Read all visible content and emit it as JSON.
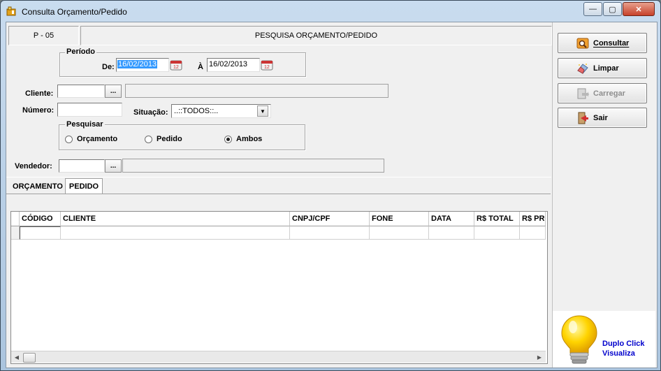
{
  "window": {
    "title": "Consulta Orçamento/Pedido",
    "minimize": "—",
    "maximize": "▢",
    "close": "✕"
  },
  "header": {
    "code": "P - 05",
    "title": "PESQUISA ORÇAMENTO/PEDIDO"
  },
  "periodo": {
    "legend": "Período",
    "from_label": "De:",
    "from_value": "16/02/2013",
    "to_label": "À",
    "to_value": "16/02/2013"
  },
  "filters": {
    "cliente_label": "Cliente:",
    "cliente_button": "...",
    "numero_label": "Número:",
    "situacao_label": "Situação:",
    "situacao_value": "..::TODOS::..",
    "vendedor_label": "Vendedor:",
    "vendedor_button": "..."
  },
  "pesquisar": {
    "legend": "Pesquisar",
    "options": [
      "Orçamento",
      "Pedido",
      "Ambos"
    ],
    "selected": "Ambos"
  },
  "tabs": [
    "ORÇAMENTO",
    "PEDIDO"
  ],
  "active_tab": "PEDIDO",
  "grid": {
    "columns": [
      "CÓDIGO",
      "CLIENTE",
      "CNPJ/CPF",
      "FONE",
      "DATA",
      "R$ TOTAL",
      "R$ PRO"
    ]
  },
  "buttons": {
    "consultar": "Consultar",
    "limpar": "Limpar",
    "carregar": "Carregar",
    "sair": "Sair"
  },
  "hint": {
    "line1": "Duplo Click",
    "line2": "Visualiza"
  },
  "colors": {
    "hint_text": "#0000cc",
    "selection": "#3399ff",
    "bulb": "#ffd400"
  }
}
